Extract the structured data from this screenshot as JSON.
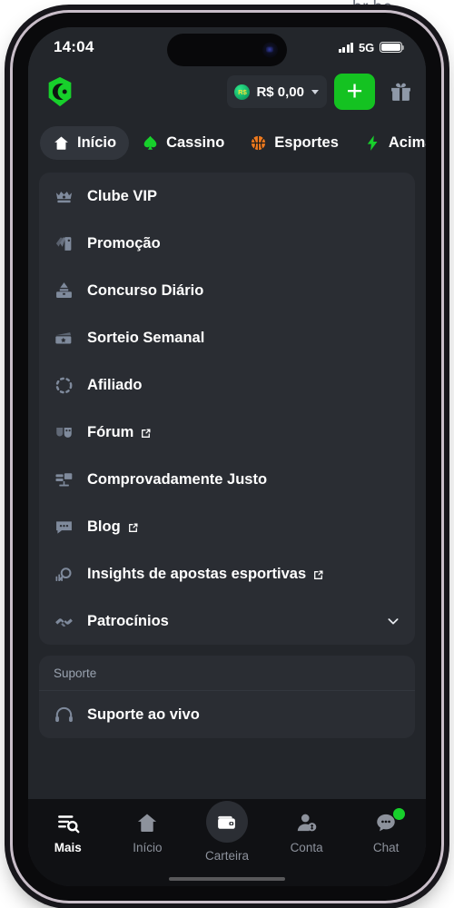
{
  "watermark": "br.bc",
  "status_bar": {
    "time": "14:04",
    "network": "5G",
    "signal_icon": "signal-bars-icon",
    "battery_icon": "battery-full-icon"
  },
  "header": {
    "logo_icon": "bc-game-logo",
    "balance": {
      "currency_icon": "brl-coin-icon",
      "amount": "R$ 0,00",
      "chevron_icon": "chevron-down-icon"
    },
    "deposit_label": "+",
    "deposit_icon": "plus-icon",
    "gift_icon": "gift-box-icon",
    "accent_green": "#14c221"
  },
  "tabs": [
    {
      "label": "Início",
      "icon": "home-icon",
      "active": true
    },
    {
      "label": "Cassino",
      "icon": "spade-icon",
      "active": false
    },
    {
      "label": "Esportes",
      "icon": "basketball-icon",
      "active": false
    },
    {
      "label": "Acima Ab",
      "icon": "lightning-icon",
      "active": false
    }
  ],
  "menu": {
    "items": [
      {
        "label": "Clube VIP",
        "icon": "crown-icon",
        "external": false,
        "chevron": false
      },
      {
        "label": "Promoção",
        "icon": "tag-icon",
        "external": false,
        "chevron": false
      },
      {
        "label": "Concurso Diário",
        "icon": "ballot-box-icon",
        "external": false,
        "chevron": false
      },
      {
        "label": "Sorteio Semanal",
        "icon": "ticket-icon",
        "external": false,
        "chevron": false
      },
      {
        "label": "Afiliado",
        "icon": "dashed-circle-icon",
        "external": false,
        "chevron": false
      },
      {
        "label": "Fórum",
        "icon": "masks-icon",
        "external": true,
        "chevron": false
      },
      {
        "label": "Comprovadamente Justo",
        "icon": "monitor-icon",
        "external": false,
        "chevron": false
      },
      {
        "label": "Blog",
        "icon": "chat-bubble-icon",
        "external": true,
        "chevron": false
      },
      {
        "label": "Insights de apostas esportivas",
        "icon": "magnifier-chart-icon",
        "external": true,
        "chevron": false
      },
      {
        "label": "Patrocínios",
        "icon": "handshake-icon",
        "external": false,
        "chevron": true
      }
    ]
  },
  "support": {
    "section_title": "Suporte",
    "items": [
      {
        "label": "Suporte ao vivo",
        "icon": "headset-icon"
      }
    ]
  },
  "bottom_nav": [
    {
      "label": "Mais",
      "icon": "list-search-icon",
      "active": true,
      "raised": false,
      "badge": false
    },
    {
      "label": "Início",
      "icon": "home-icon",
      "active": false,
      "raised": false,
      "badge": false
    },
    {
      "label": "Carteira",
      "icon": "wallet-icon",
      "active": false,
      "raised": true,
      "badge": false
    },
    {
      "label": "Conta",
      "icon": "user-coin-icon",
      "active": false,
      "raised": false,
      "badge": false
    },
    {
      "label": "Chat",
      "icon": "chat-dots-icon",
      "active": false,
      "raised": false,
      "badge": true
    }
  ]
}
